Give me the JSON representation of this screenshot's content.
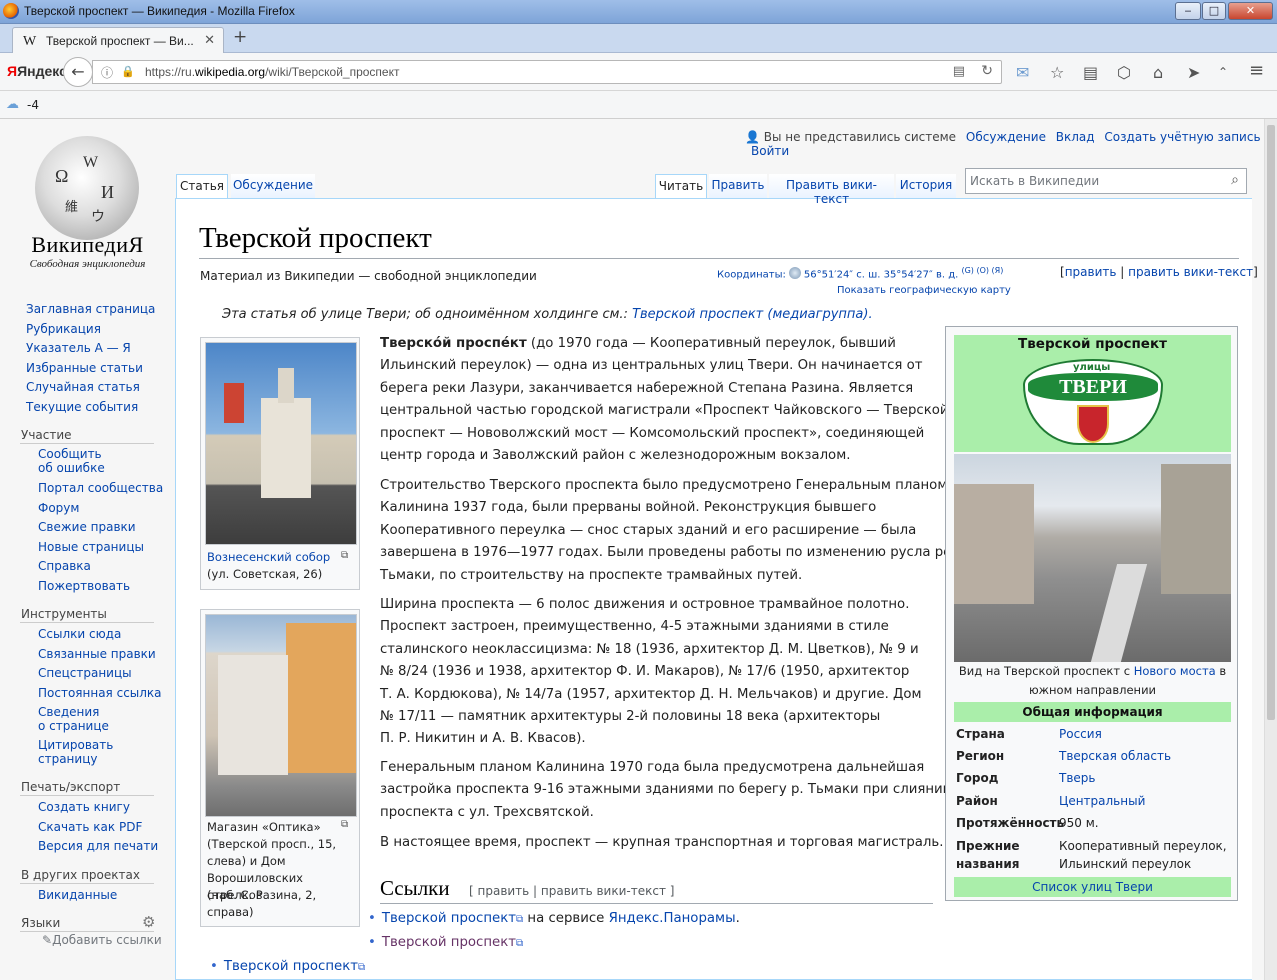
{
  "window": {
    "title": "Тверской проспект — Википедия - Mozilla Firefox",
    "buttons": {
      "minimize": "‒",
      "maximize": "□",
      "close": "✕"
    }
  },
  "tab": {
    "favicon": "W",
    "title": "Тверской проспект — Ви...",
    "close": "✕",
    "new": "+"
  },
  "nav": {
    "yandex_label": "Яндекс",
    "url_prefix": "https://ru.",
    "url_domain": "wikipedia.org",
    "url_path": "/wiki/Тверской_проспект"
  },
  "weather": {
    "temp": "-4"
  },
  "logo": {
    "name": "ВикипедиЯ",
    "slogan": "Свободная энциклопедия"
  },
  "sidebar": {
    "main": [
      "Заглавная страница",
      "Рубрикация",
      "Указатель А — Я",
      "Избранные статьи",
      "Случайная статья",
      "Текущие события"
    ],
    "participation_title": "Участие",
    "participation": [
      "Сообщить",
      "об ошибке",
      "Портал сообщества",
      "Форум",
      "Свежие правки",
      "Новые страницы",
      "Справка",
      "Пожертвовать"
    ],
    "tools_title": "Инструменты",
    "tools": [
      "Ссылки сюда",
      "Связанные правки",
      "Спецстраницы",
      "Постоянная ссылка",
      "Сведения",
      "о странице",
      "Цитировать",
      "страницу"
    ],
    "print_title": "Печать/экспорт",
    "print": [
      "Создать книгу",
      "Скачать как PDF",
      "Версия для печати"
    ],
    "projects_title": "В других проектах",
    "projects": [
      "Викиданные"
    ],
    "languages_title": "Языки",
    "add_links": "Добавить ссылки"
  },
  "personal": {
    "not_logged": "Вы не представились системе",
    "links": [
      "Обсуждение",
      "Вклад",
      "Создать учётную запись",
      "Войти"
    ]
  },
  "tabs": {
    "article": "Статья",
    "talk": "Обсуждение",
    "read": "Читать",
    "edit": "Править",
    "edit_source": "Править вики-текст",
    "history": "История"
  },
  "search": {
    "placeholder": "Искать в Википедии"
  },
  "article": {
    "title": "Тверской проспект",
    "from": "Материал из Википедии — свободной энциклопедии",
    "coordinates_label": "Координаты:",
    "coordinates_value": "56°51′24″ с. ш. 35°54′27″ в. д.",
    "coordinates_links": "(G) (O) (Я)",
    "geomap": "Показать географическую карту",
    "edit": "править",
    "edit_source": "править вики-текст",
    "hatnote_text": "Эта статья об улице Твери; об одноимённом холдинге см.:",
    "hatnote_link": "Тверской проспект (медиагруппа).",
    "paragraph_lines": [
      [
        "Тверско́й проспе́кт (до 1970 года — Кооперативный переулок, бывший",
        "Ильинский переулок) — одна из центральных улиц Твери. Он начинается от",
        "берега реки Лазури, заканчивается набережной Степана Разина. Является",
        "центральной частью городской магистрали «Проспект Чайковского — Тверской",
        "проспект — Нововолжский мост — Комсомольский проспект», соединяющей",
        "центр города и Заволжский район с железнодорожным вокзалом."
      ],
      [
        "Строительство Тверского проспекта было предусмотрено Генеральным планом",
        "Калинина 1937 года, были прерваны войной. Реконструкция бывшего",
        "Кооперативного переулка — снос старых зданий и его расширение — была",
        "завершена в 1976—1977 годах. Были проведены работы по изменению русла реки",
        "Тьмаки, по строительству на проспекте трамвайных путей."
      ],
      [
        "Ширина проспекта — 6 полос движения и островное трамвайное полотно.",
        "Проспект застроен, преимущественно, 4-5 этажными зданиями в стиле",
        "сталинского неоклассицизма: № 18 (1936, архитектор Д. М. Цветков), № 9 и",
        "№ 8/24 (1936 и 1938, архитектор Ф. И. Макаров), № 17/6 (1950, архитектор",
        "Т. А. Кордюкова), № 14/7а (1957, архитектор Д. Н. Мельчаков) и другие. Дом",
        "№ 17/11 — памятник архитектуры 2-й половины 18 века (архитекторы",
        "П. Р. Никитин и А. В. Квасов)."
      ],
      [
        "Генеральным планом Калинина 1970 года была предусмотрена дальнейшая",
        "застройка проспекта 9-16 этажными зданиями по берегу р. Тьмаки при слиянии",
        "проспекта с ул. Трехсвятской."
      ],
      [
        "В настоящее время, проспект — крупная транспортная и торговая магистраль."
      ]
    ],
    "thumb1_caption_link": "Вознесенский собор",
    "thumb1_caption": "(ул. Советская, 26)",
    "thumb2_caption": [
      "Магазин «Оптика»",
      "(Тверской просп., 15,",
      "слева) и Дом",
      "Ворошиловских стрелков",
      "(наб. С. Разина, 2,",
      "справа)"
    ],
    "links_heading": "Ссылки",
    "links_edit": "[ править | править вики-текст ]",
    "links": [
      {
        "text": "Тверской проспект",
        "suffix": " на сервисе ",
        "extra": "Яндекс.Панорамы",
        "end": "."
      },
      {
        "text": "Тверской проспект",
        "suffix": "",
        "extra": "",
        "end": ""
      },
      {
        "text": "Тверской проспект",
        "suffix": "",
        "extra": "",
        "end": ""
      }
    ]
  },
  "infobox": {
    "title": "Тверской проспект",
    "emblem_top": "улицы",
    "emblem_main": "ТВЕРИ",
    "photo_caption_1": "Вид на Тверской проспект с",
    "photo_caption_link": "Нового моста",
    "photo_caption_2": "в",
    "photo_caption_3": "южном направлении",
    "general": "Общая информация",
    "rows": [
      {
        "k": "Страна",
        "v": "Россия"
      },
      {
        "k": "Регион",
        "v": "Тверская область"
      },
      {
        "k": "Город",
        "v": "Тверь"
      },
      {
        "k": "Район",
        "v": "Центральный"
      },
      {
        "k": "Протяжённость",
        "v": "950 м."
      },
      {
        "k": "Прежние",
        "k2": "названия",
        "v": "Кооперативный переулок,",
        "v2": "Ильинский переулок"
      }
    ],
    "footer": "Список улиц Твери"
  },
  "colors": {
    "link": "#0645ad",
    "infobox_green": "#aaeeaa",
    "content_border": "#a7d7f9"
  }
}
